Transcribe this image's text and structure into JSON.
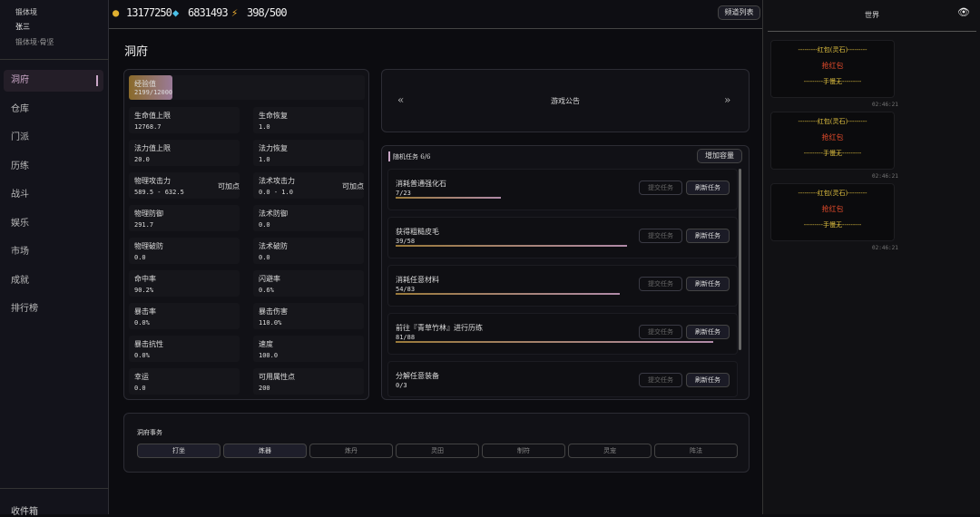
{
  "profile": {
    "realm": "锻体境",
    "name": "张三",
    "stage": "锻体境·骨坚"
  },
  "nav": [
    "洞府",
    "仓库",
    "门派",
    "历练",
    "战斗",
    "娱乐",
    "市场",
    "成就",
    "排行榜"
  ],
  "mailbox": "收件箱",
  "resources": {
    "gold": "13177250",
    "gems": "6831493",
    "energy": "398/500"
  },
  "channel_list": "频道列表",
  "page_title": "洞府",
  "exp": {
    "label": "经验值",
    "value": "2199/12000",
    "fraction": 0.183
  },
  "stats": [
    {
      "label": "生命值上限",
      "value": "12768.7"
    },
    {
      "label": "生命恢复",
      "value": "1.0"
    },
    {
      "label": "法力值上限",
      "value": "20.0"
    },
    {
      "label": "法力恢复",
      "value": "1.0"
    },
    {
      "label": "物理攻击力",
      "value": "589.5 - 632.5",
      "add": "可加点"
    },
    {
      "label": "法术攻击力",
      "value": "0.0 - 1.0",
      "add": "可加点"
    },
    {
      "label": "物理防御",
      "value": "291.7"
    },
    {
      "label": "法术防御",
      "value": "0.0"
    },
    {
      "label": "物理破防",
      "value": "0.0"
    },
    {
      "label": "法术破防",
      "value": "0.0"
    },
    {
      "label": "命中率",
      "value": "90.2%"
    },
    {
      "label": "闪避率",
      "value": "0.6%"
    },
    {
      "label": "暴击率",
      "value": "0.0%"
    },
    {
      "label": "暴击伤害",
      "value": "110.0%"
    },
    {
      "label": "暴击抗性",
      "value": "0.0%"
    },
    {
      "label": "速度",
      "value": "100.0"
    },
    {
      "label": "幸运",
      "value": "0.0"
    },
    {
      "label": "可用属性点",
      "value": "200"
    }
  ],
  "announcement": {
    "title": "游戏公告",
    "prev": "«",
    "next": "»"
  },
  "tasks": {
    "header": "随机任务 6/6",
    "expand": "增加容量",
    "submit": "提交任务",
    "refresh": "刷新任务",
    "items": [
      {
        "name": "消耗普通强化石",
        "progress": "7/23",
        "fraction": 0.304
      },
      {
        "name": "获得粗糙皮毛",
        "progress": "39/58",
        "fraction": 0.672
      },
      {
        "name": "消耗任意材料",
        "progress": "54/83",
        "fraction": 0.651
      },
      {
        "name": "前往『青草竹林』进行历练",
        "progress": "81/88",
        "fraction": 0.92
      },
      {
        "name": "分解任意装备",
        "progress": "0/3",
        "fraction": 0
      }
    ]
  },
  "affairs": {
    "title": "洞府事务",
    "buttons": [
      {
        "label": "打坐",
        "active": true
      },
      {
        "label": "炼器",
        "active": true
      },
      {
        "label": "炼丹",
        "active": false
      },
      {
        "label": "灵田",
        "active": false
      },
      {
        "label": "制符",
        "active": false
      },
      {
        "label": "灵宠",
        "active": false
      },
      {
        "label": "阵法",
        "active": false
      }
    ]
  },
  "chat": {
    "title": "世界",
    "messages": [
      {
        "top": "---------红包(灵石)---------",
        "grab": "抢红包",
        "bottom": "---------手慢无---------",
        "time": "02:46:21"
      },
      {
        "top": "---------红包(灵石)---------",
        "grab": "抢红包",
        "bottom": "---------手慢无---------",
        "time": "02:46:21"
      },
      {
        "top": "---------红包(灵石)---------",
        "grab": "抢红包",
        "bottom": "---------手慢无---------",
        "time": "02:46:21"
      }
    ]
  },
  "colors": {
    "accent": "#c9a6c6",
    "gold": "#e0c040",
    "red": "#e04a2a"
  }
}
